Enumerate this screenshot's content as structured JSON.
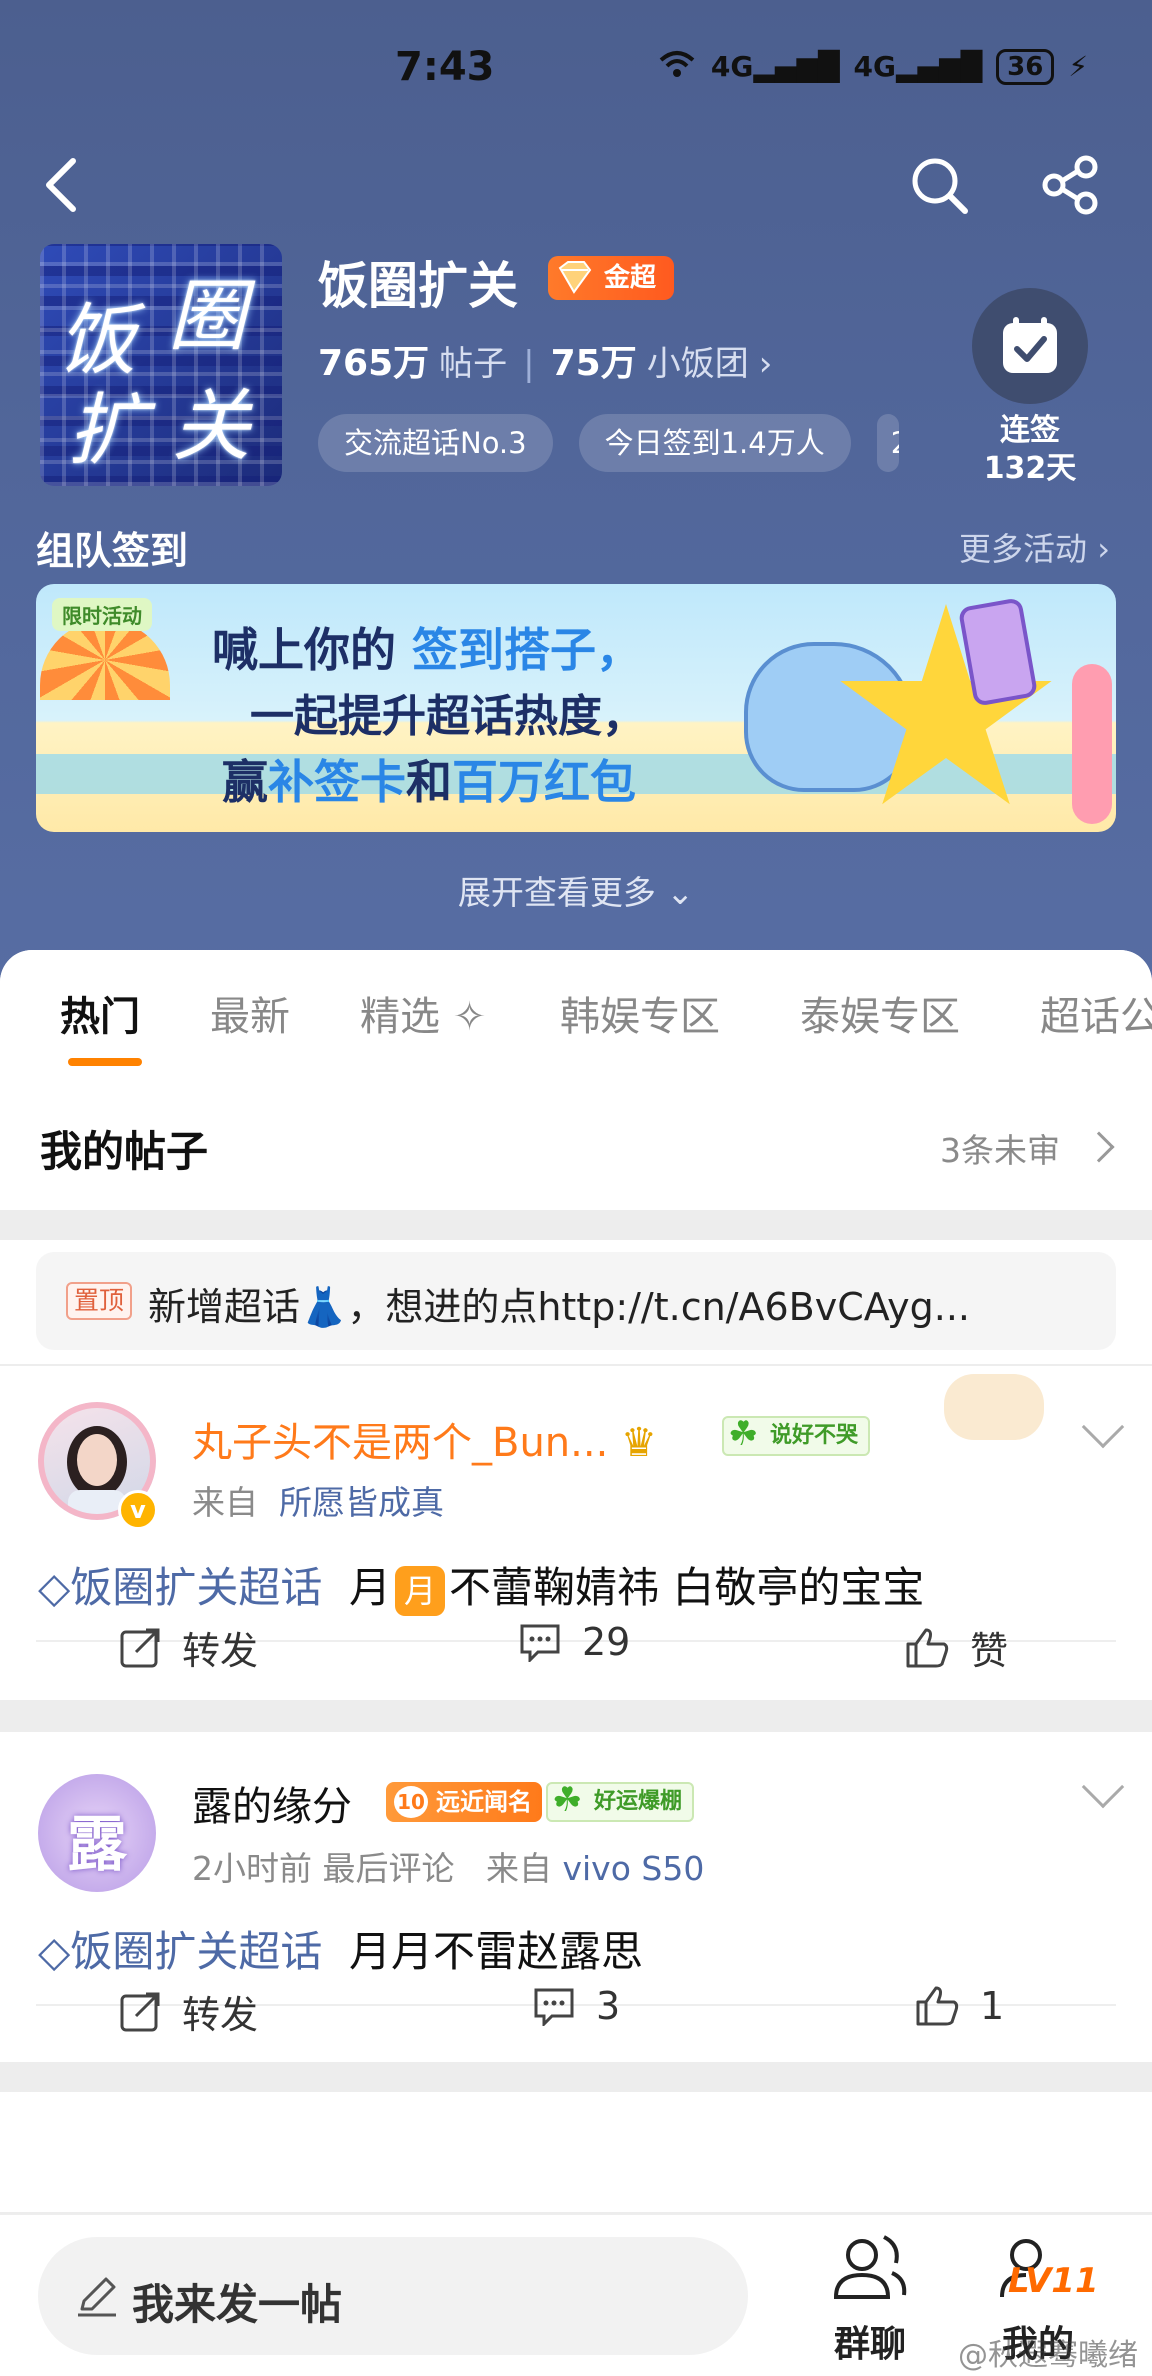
{
  "status_bar": {
    "time": "7:43",
    "network": "4G",
    "battery": "36"
  },
  "header": {
    "community_name": "饭圈扩关",
    "logo_chars": [
      "饭",
      "圈",
      "扩",
      "关"
    ],
    "badge": "金超",
    "posts_count": "765万",
    "posts_label": "帖子",
    "members_count": "75万",
    "members_label": "小饭团",
    "tags": [
      "交流超话No.3",
      "今日签到1.4万人",
      "2"
    ],
    "checkin_label": "连签",
    "checkin_days": "132天"
  },
  "activity": {
    "title": "组队签到",
    "more": "更多活动",
    "banner": {
      "limited": "限时活动",
      "line1_a": "喊上你的",
      "line1_b": "签到搭子，",
      "line2": "一起提升超话热度，",
      "line3_a": "赢",
      "line3_b": "补签卡",
      "line3_c": "和",
      "line3_d": "百万红包"
    },
    "expand": "展开查看更多"
  },
  "tabs": [
    "热门",
    "最新",
    "精选",
    "韩娱专区",
    "泰娱专区",
    "超话公"
  ],
  "my_posts": {
    "label": "我的帖子",
    "unreviewed": "3条未审"
  },
  "pinned": {
    "badge": "置顶",
    "text": "新增超话👗，想进的点http://t.cn/A6BvCAyg..."
  },
  "posts": [
    {
      "username": "丸子头不是两个_Bun...",
      "badge": "说好不哭",
      "source_prefix": "来自",
      "source": "所愿皆成真",
      "topic": "饭圈扩关超话",
      "body_a": "月",
      "moon": "月",
      "body_b": "不蕾鞠婧祎 白敬亭的宝宝",
      "repost": "转发",
      "comments": "29",
      "likes": "赞"
    },
    {
      "username": "露的缘分",
      "avatar_char": "露",
      "rank_num": "10",
      "rank_badge": "远近闻名",
      "badge": "好运爆棚",
      "time": "2小时前",
      "last_comment": "最后评论",
      "source_prefix": "来自",
      "source": "vivo S50",
      "topic": "饭圈扩关超话",
      "body": "月月不雷赵露思",
      "repost": "转发",
      "comments": "3",
      "likes": "1"
    }
  ],
  "bottom_bar": {
    "compose": "我来发一帖",
    "group_chat": "群聊",
    "mine": "我的",
    "level": "LV11"
  },
  "watermark": "@秋遐骞曦绪",
  "colors": {
    "header_bg": "#51669a",
    "accent": "#ff8200",
    "link": "#4e6aa6"
  }
}
